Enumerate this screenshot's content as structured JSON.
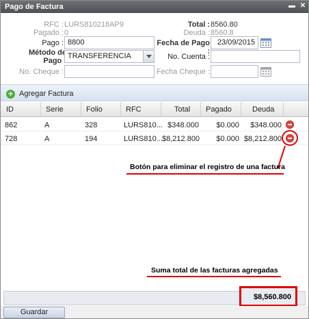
{
  "window": {
    "title": "Pago de Factura"
  },
  "form": {
    "rfc_label": "RFC :",
    "rfc_value": "LURS810218AP9",
    "pagado_label": "Pagado :",
    "pagado_value": "0",
    "total_label": "Total :",
    "total_value": "8560.80",
    "deuda_label": "Deuda :",
    "deuda_value": "8560.8",
    "pago_label": "Pago :",
    "pago_value": "8800",
    "fecha_pago_label": "Fecha de Pago :",
    "fecha_pago_value": "23/09/2015",
    "metodo_label_1": "Método de",
    "metodo_label_2": "Pago :",
    "metodo_value": "TRANSFERENCIA",
    "no_cuenta_label": "No. Cuenta :",
    "no_cuenta_value": "",
    "no_cheque_label": "No. Cheque :",
    "no_cheque_value": "",
    "fecha_cheque_label": "Fecha Cheque :",
    "fecha_cheque_value": ""
  },
  "toolbar": {
    "add_label": "Agregar Factura"
  },
  "grid": {
    "columns": [
      "ID",
      "Serie",
      "Folio",
      "RFC",
      "Total",
      "Pagado",
      "Deuda"
    ],
    "rows": [
      {
        "id": "862",
        "serie": "A",
        "folio": "328",
        "rfc": "LURS810...",
        "total": "$348.000",
        "pagado": "$0.000",
        "deuda": "$348.000"
      },
      {
        "id": "728",
        "serie": "A",
        "folio": "194",
        "rfc": "LURS810...",
        "total": "$8,212.800",
        "pagado": "$0.000",
        "deuda": "$8,212.800"
      }
    ]
  },
  "annotations": {
    "delete_note": "Botón para eliminar el registro de una factura",
    "sum_note": "Suma total de las facturas agregadas"
  },
  "summary": {
    "total": "$8,560.800"
  },
  "footer": {
    "save_label": "Guardar"
  },
  "colors": {
    "annotation": "#e00000",
    "toolbar": "#d6e2f1",
    "titlebar": "#5a5d61"
  }
}
